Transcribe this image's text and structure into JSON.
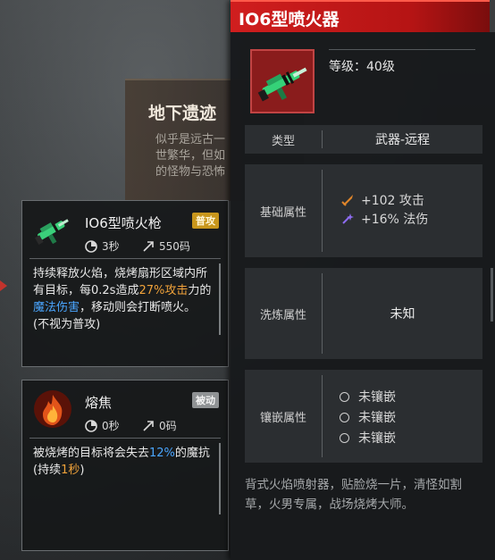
{
  "background": {
    "card_title": "地下遗迹",
    "card_desc": "似乎是远古一\n世繁华，但如\n的怪物与恐怖"
  },
  "skills": [
    {
      "name": "IO6型喷火枪",
      "tag": "普攻",
      "cooldown": "3秒",
      "range": "550码",
      "desc_parts": [
        "持续释放火焰，烧烤扇形区域内所有目标，每0.2s造成",
        "27%攻击",
        "力的",
        "魔法伤害",
        "，移动则会打断喷火。(不视为普攻)"
      ]
    },
    {
      "name": "熔焦",
      "tag": "被动",
      "cooldown": "0秒",
      "range": "0码",
      "desc_parts": [
        "被烧烤的目标将会失去",
        "12%",
        "的魔抗 (持续",
        "1秒",
        ")"
      ]
    }
  ],
  "item": {
    "title": "IO6型喷火器",
    "level": "等级：40级",
    "rows": {
      "type_label": "类型",
      "type_value": "武器-远程",
      "base_label": "基础属性",
      "base_attrs": [
        {
          "icon": "sword-icon",
          "text": "+102 攻击",
          "color": "#e0852a"
        },
        {
          "icon": "magic-wand-icon",
          "text": "+16% 法伤",
          "color": "#8d6cf0"
        }
      ],
      "refine_label": "洗炼属性",
      "refine_value": "未知",
      "socket_label": "镶嵌属性",
      "sockets": [
        "未镶嵌",
        "未镶嵌",
        "未镶嵌"
      ]
    },
    "flavor": "背式火焰喷射器，贴脸烧一片，清怪如割草，火男专属，战场烧烤大师。"
  },
  "colors": {
    "header_red": "#c81818",
    "tag_gold": "#c8961c",
    "highlight_orange": "#f0a23a",
    "highlight_blue": "#4aa6ff"
  }
}
